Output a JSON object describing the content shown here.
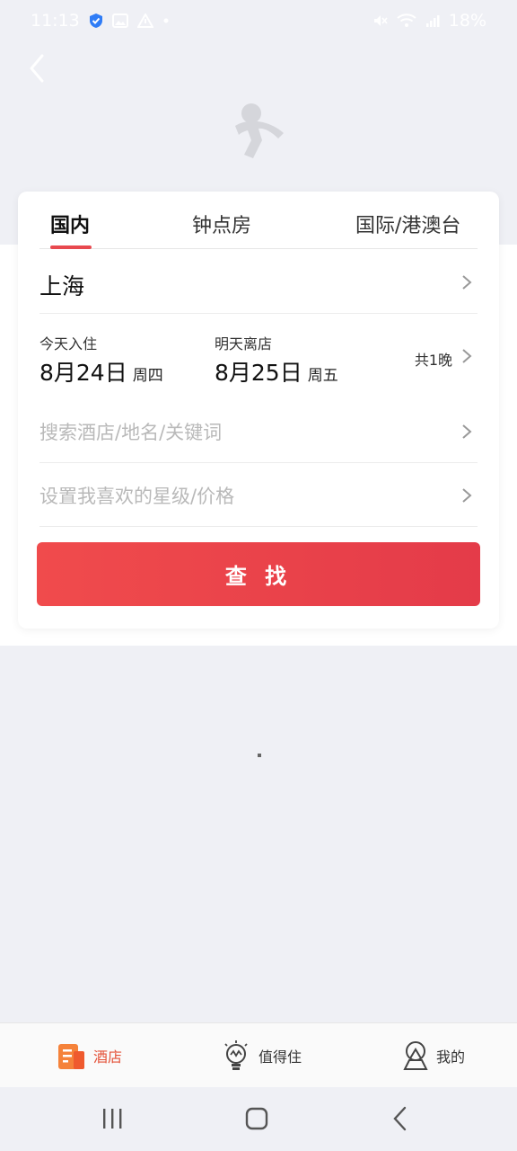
{
  "status_bar": {
    "time": "11:13",
    "battery": "18%",
    "icons": [
      "shield-check-icon",
      "image-icon",
      "warning-icon",
      "dot-icon",
      "mute-icon",
      "wifi-icon",
      "signal-icon"
    ]
  },
  "header": {
    "back_icon": "chevron-left-icon",
    "logo_icon": "person-logo-icon"
  },
  "tabs": [
    {
      "label": "国内",
      "active": true
    },
    {
      "label": "钟点房",
      "active": false
    },
    {
      "label": "国际/港澳台",
      "active": false
    }
  ],
  "city": "上海",
  "checkin": {
    "label": "今天入住",
    "date": "8月24日",
    "weekday": "周四"
  },
  "checkout": {
    "label": "明天离店",
    "date": "8月25日",
    "weekday": "周五"
  },
  "nights": "共1晚",
  "search_placeholder": "搜索酒店/地名/关键词",
  "preference_placeholder": "设置我喜欢的星级/价格",
  "search_button": "查 找",
  "bottom_nav": [
    {
      "label": "酒店",
      "icon": "hotel-icon",
      "active": true
    },
    {
      "label": "值得住",
      "icon": "lightbulb-icon",
      "active": false
    },
    {
      "label": "我的",
      "icon": "profile-icon",
      "active": false
    }
  ],
  "system_nav": [
    "recents-icon",
    "home-icon",
    "back-icon"
  ],
  "colors": {
    "accent": "#e8494f",
    "button_start": "#f04b4c",
    "button_end": "#e43b49",
    "nav_active": "#e4533a",
    "background": "#eff0f5"
  }
}
